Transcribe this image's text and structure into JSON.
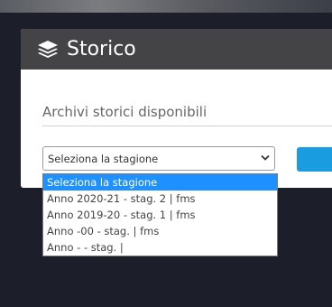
{
  "panel": {
    "title": "Storico",
    "icon": "layers-icon"
  },
  "archive": {
    "label": "Archivi storici disponibili"
  },
  "season_select": {
    "value": "Seleziona la stagione",
    "chevron_icon": "chevron-down-icon"
  },
  "dropdown": {
    "options": [
      "Seleziona la stagione",
      "Anno 2020-21 - stag. 2 | fms",
      "Anno 2019-20 - stag. 1 | fms",
      "Anno -00 - stag. | fms",
      "Anno - - stag. |"
    ],
    "selected_index": 0
  },
  "colors": {
    "page_background": "#1c1e29",
    "header_background": "#444446",
    "accent": "#1a9ce0",
    "selected_option": "#1e90ff"
  }
}
